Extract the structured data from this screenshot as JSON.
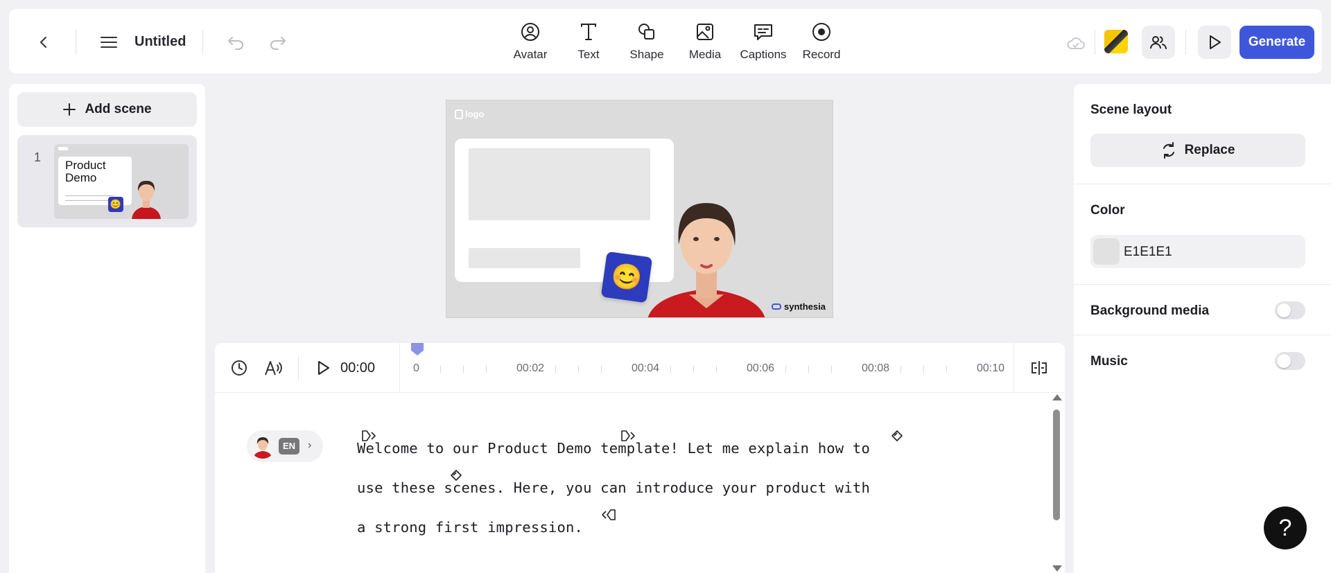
{
  "header": {
    "title": "Untitled",
    "tools": [
      {
        "label": "Avatar",
        "icon": "avatar-icon"
      },
      {
        "label": "Text",
        "icon": "text-icon"
      },
      {
        "label": "Shape",
        "icon": "shape-icon"
      },
      {
        "label": "Media",
        "icon": "media-icon"
      },
      {
        "label": "Captions",
        "icon": "captions-icon"
      },
      {
        "label": "Record",
        "icon": "record-icon"
      }
    ],
    "generate_label": "Generate"
  },
  "sidebar": {
    "add_scene_label": "Add scene",
    "scenes": [
      {
        "number": "1",
        "title": "Product Demo"
      }
    ]
  },
  "slide": {
    "logo_text": "logo",
    "brand": "synthesia",
    "emoji": "😊"
  },
  "timeline": {
    "time": "00:00",
    "ticks": [
      "0",
      "00:02",
      "00:04",
      "00:06",
      "00:08",
      "00:10"
    ]
  },
  "script": {
    "language": "EN",
    "lines": [
      "Welcome to our Product Demo template! Let me explain how to",
      "use these scenes. Here, you can introduce your product with",
      "a strong first impression."
    ]
  },
  "properties": {
    "scene_layout_title": "Scene layout",
    "replace_label": "Replace",
    "color_title": "Color",
    "color_value": "E1E1E1",
    "background_media_label": "Background media",
    "background_media_on": false,
    "music_label": "Music",
    "music_on": false
  },
  "help_label": "?",
  "colors": {
    "accent": "#3e57da",
    "swatch": "#E1E1E1"
  }
}
